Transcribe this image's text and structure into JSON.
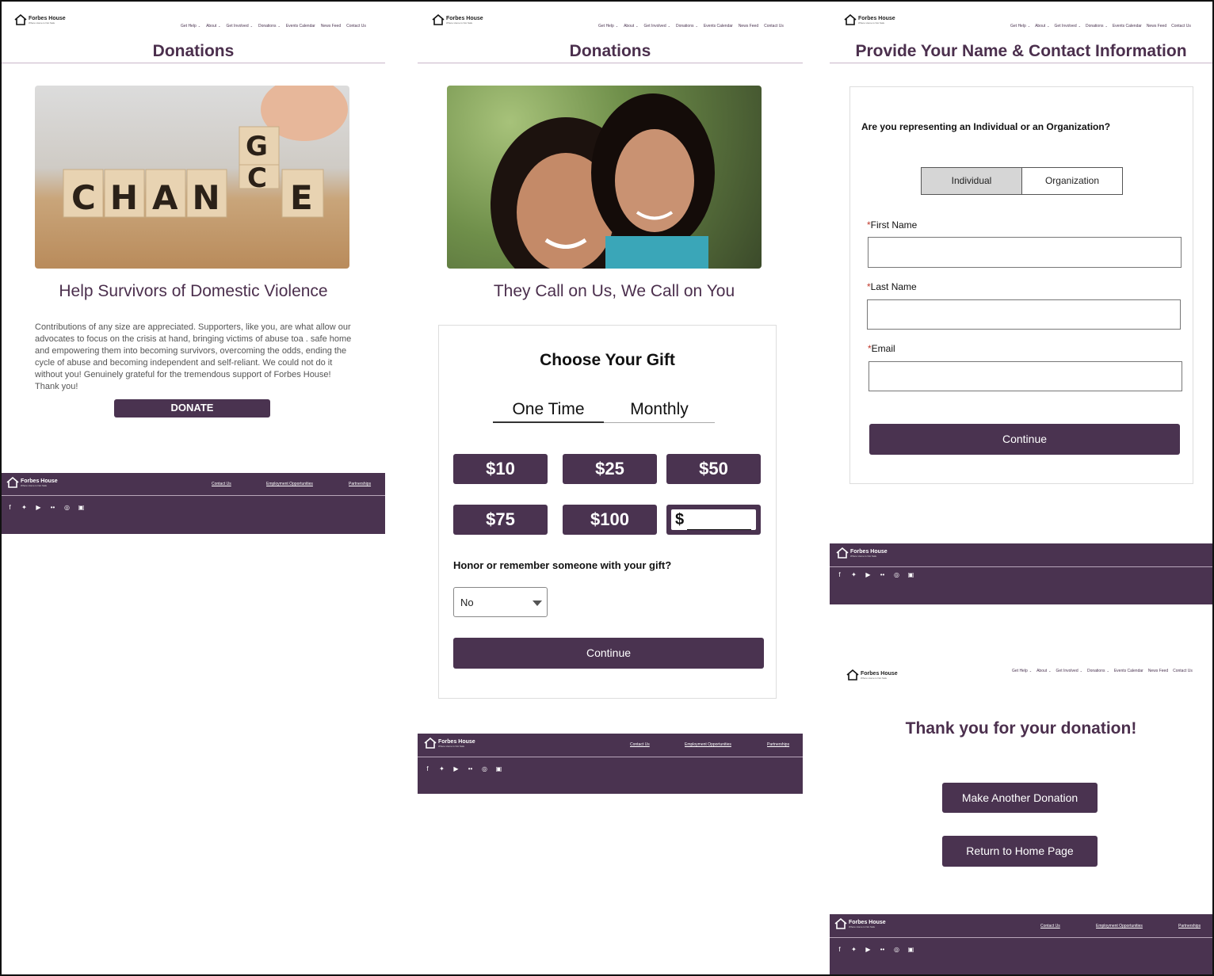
{
  "brand": {
    "name": "Forbes House",
    "tagline": "Where Home is Not Safe"
  },
  "nav": [
    "Get Help",
    "About",
    "Get Involved",
    "Donations",
    "Events Calendar",
    "News Feed",
    "Contact Us"
  ],
  "nav_dropdown_flags": [
    true,
    true,
    true,
    true,
    false,
    false,
    false
  ],
  "footer": {
    "links": [
      "Contact Us",
      "Employment Opportunities",
      "Partnerships"
    ],
    "social_icons": [
      "facebook-icon",
      "twitter-icon",
      "youtube-icon",
      "flickr-icon",
      "instagram-icon",
      "linkedin-icon"
    ]
  },
  "panel1": {
    "title": "Donations",
    "subtitle": "Help Survivors of Domestic Violence",
    "image_word": "CHAN",
    "image_letter_e": "E",
    "image_letter_g": "G",
    "image_letter_c": "C",
    "body": "Contributions of any size are appreciated. Supporters, like you, are what allow our advocates to focus on the crisis at hand, bringing victims of abuse toa . safe home and empowering them into becoming survivors, overcoming the odds, ending the cycle of abuse and becoming independent and self-reliant. We could not do it without you! Genuinely grateful for the tremendous support of Forbes House! Thank you!",
    "donate_label": "DONATE"
  },
  "panel2": {
    "title": "Donations",
    "subtitle": "They Call on Us, We Call on You",
    "card_title": "Choose Your Gift",
    "tabs": [
      "One Time",
      "Monthly"
    ],
    "active_tab": "One Time",
    "amounts": [
      "$10",
      "$25",
      "$50",
      "$75",
      "$100"
    ],
    "custom_prefix": "$",
    "honor_question": "Honor or remember someone with your gift?",
    "honor_selected": "No",
    "continue_label": "Continue"
  },
  "panel3": {
    "title": "Provide Your Name & Contact Information",
    "question": "Are you representing an Individual or an Organization?",
    "options": [
      "Individual",
      "Organization"
    ],
    "selected_option": "Individual",
    "required_mark": "*",
    "fields": [
      "First Name",
      "Last Name",
      "Email"
    ],
    "continue_label": "Continue"
  },
  "panel4": {
    "thanks": "Thank you for your donation!",
    "another_label": "Make Another Donation",
    "home_label": "Return to Home Page"
  },
  "colors": {
    "brand_purple": "#4a3350",
    "title_purple": "#4b2f4d"
  }
}
